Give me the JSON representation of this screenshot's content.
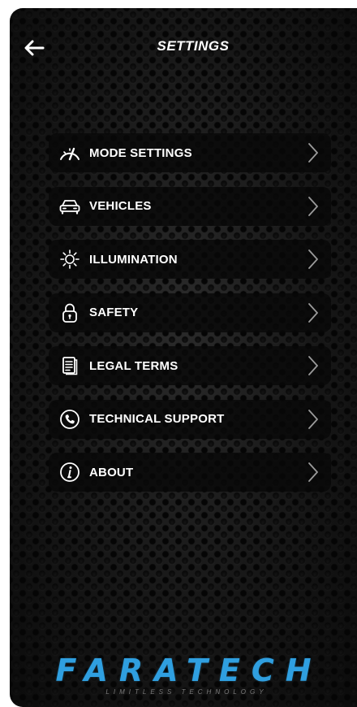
{
  "header": {
    "title": "SETTINGS",
    "back_icon": "arrow-left-icon"
  },
  "menu": {
    "items": [
      {
        "label": "MODE SETTINGS",
        "icon": "speedometer-icon"
      },
      {
        "label": "VEHICLES",
        "icon": "car-icon"
      },
      {
        "label": "ILLUMINATION",
        "icon": "sun-icon"
      },
      {
        "label": "SAFETY",
        "icon": "lock-icon"
      },
      {
        "label": "LEGAL TERMS",
        "icon": "document-icon"
      },
      {
        "label": "TECHNICAL SUPPORT",
        "icon": "phone-icon"
      },
      {
        "label": "ABOUT",
        "icon": "info-icon"
      }
    ],
    "chevron_icon": "chevron-right-icon"
  },
  "footer": {
    "brand": "FARATECH",
    "tagline": "LIMITLESS TECHNOLOGY"
  },
  "colors": {
    "background": "#151515",
    "text": "#ffffff",
    "brand": "#2f9fe0",
    "item_bg": "#080808"
  }
}
